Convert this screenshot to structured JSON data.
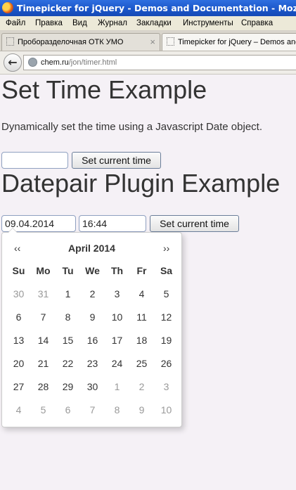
{
  "window": {
    "title": "Timepicker for jQuery - Demos and Documentation - Mozilla Firefox"
  },
  "menu": [
    "Файл",
    "Правка",
    "Вид",
    "Журнал",
    "Закладки",
    "Инструменты",
    "Справка"
  ],
  "tabs": [
    {
      "label": "Пробоpазделочная ОТК УМО",
      "active": false
    },
    {
      "label": "Timepicker for jQuery – Demos and Documentation",
      "active": true
    }
  ],
  "address": {
    "domain": "chem.ru",
    "path": "/jon/timer.html"
  },
  "page": {
    "section1": {
      "title": "Set Time Example",
      "description": "Dynamically set the time using a Javascript Date object.",
      "input_value": "",
      "button_label": "Set current time"
    },
    "section2": {
      "title": "Datepair Plugin Example",
      "date_value": "09.04.2014",
      "time_value": "16:44",
      "button_label": "Set current time"
    }
  },
  "datepicker": {
    "prev": "‹‹",
    "next": "››",
    "title": "April 2014",
    "weekdays": [
      "Su",
      "Mo",
      "Tu",
      "We",
      "Th",
      "Fr",
      "Sa"
    ],
    "weeks": [
      [
        {
          "d": "30",
          "m": true
        },
        {
          "d": "31",
          "m": true
        },
        {
          "d": "1"
        },
        {
          "d": "2"
        },
        {
          "d": "3"
        },
        {
          "d": "4"
        },
        {
          "d": "5"
        }
      ],
      [
        {
          "d": "6"
        },
        {
          "d": "7"
        },
        {
          "d": "8"
        },
        {
          "d": "9"
        },
        {
          "d": "10"
        },
        {
          "d": "11"
        },
        {
          "d": "12"
        }
      ],
      [
        {
          "d": "13"
        },
        {
          "d": "14"
        },
        {
          "d": "15"
        },
        {
          "d": "16"
        },
        {
          "d": "17"
        },
        {
          "d": "18"
        },
        {
          "d": "19"
        }
      ],
      [
        {
          "d": "20"
        },
        {
          "d": "21"
        },
        {
          "d": "22"
        },
        {
          "d": "23"
        },
        {
          "d": "24"
        },
        {
          "d": "25"
        },
        {
          "d": "26"
        }
      ],
      [
        {
          "d": "27"
        },
        {
          "d": "28"
        },
        {
          "d": "29"
        },
        {
          "d": "30"
        },
        {
          "d": "1",
          "m": true
        },
        {
          "d": "2",
          "m": true
        },
        {
          "d": "3",
          "m": true
        }
      ],
      [
        {
          "d": "4",
          "m": true
        },
        {
          "d": "5",
          "m": true
        },
        {
          "d": "6",
          "m": true
        },
        {
          "d": "7",
          "m": true
        },
        {
          "d": "8",
          "m": true
        },
        {
          "d": "9",
          "m": true
        },
        {
          "d": "10",
          "m": true
        }
      ]
    ]
  }
}
